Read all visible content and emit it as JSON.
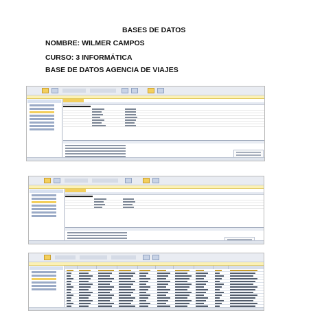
{
  "document": {
    "title": "BASES DE DATOS",
    "nombre": "NOMBRE: WILMER CAMPOS",
    "curso": "CURSO: 3 INFORMÁTICA",
    "base": "BASE DE DATOS  AGENCIA DE VIAJES"
  },
  "screenshots": [
    {
      "kind": "table-design-view",
      "accent": "#f3cf5d"
    },
    {
      "kind": "table-design-view",
      "accent": "#f3cf5d"
    },
    {
      "kind": "table-datasheet-view",
      "accent": "#f3cf5d"
    }
  ]
}
